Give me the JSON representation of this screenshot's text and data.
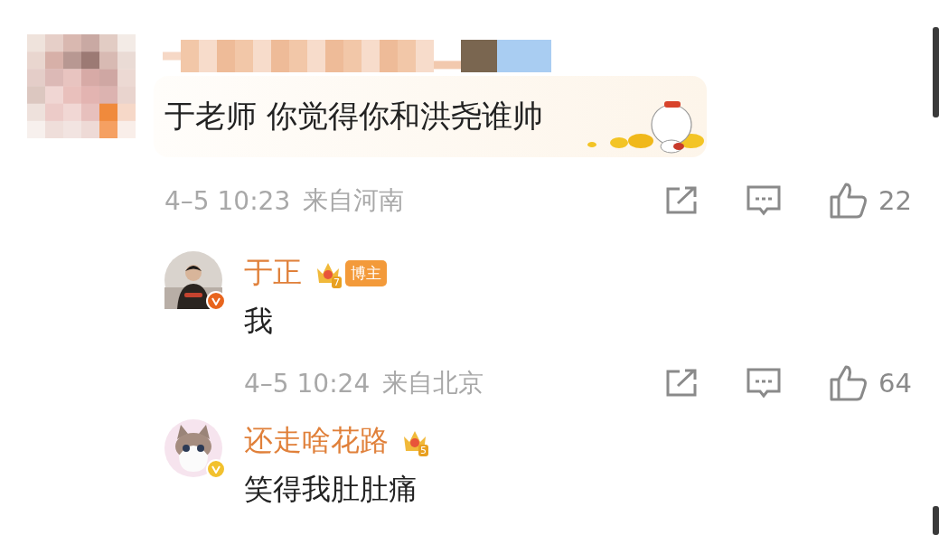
{
  "comment": {
    "text": "于老师 你觉得你和洪尧谁帅",
    "time": "4–5 10:23",
    "location": "来自河南",
    "likes": "22",
    "replies": [
      {
        "name": "于正",
        "crown_level": "7",
        "badge": "博主",
        "color": "#e8651e",
        "text": "我",
        "time": "4–5 10:24",
        "location": "来自北京",
        "likes": "64",
        "kind": "man"
      },
      {
        "name": "还走啥花路",
        "crown_level": "5",
        "color": "#f2c12e",
        "text": "笑得我肚肚痛",
        "kind": "cat"
      }
    ]
  }
}
